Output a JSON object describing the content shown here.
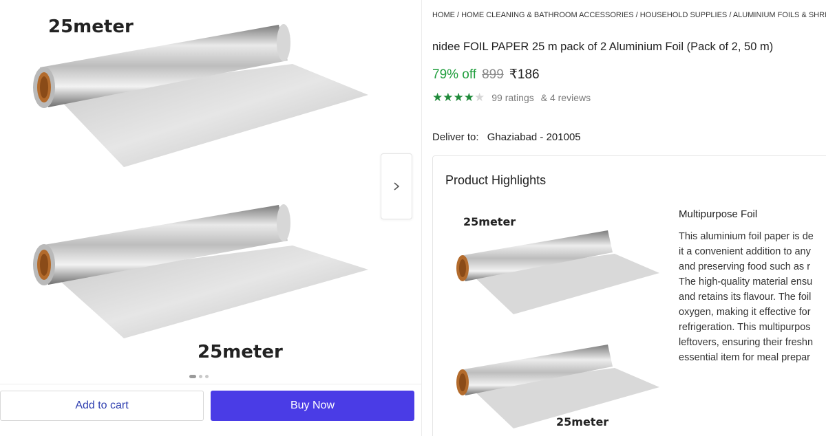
{
  "gallery": {
    "label_top": "25meter",
    "label_bottom": "25meter",
    "dots": 3,
    "active_dot": 0
  },
  "actions": {
    "add_to_cart": "Add to cart",
    "buy_now": "Buy Now"
  },
  "breadcrumb": "HOME / HOME CLEANING & BATHROOM ACCESSORIES / HOUSEHOLD SUPPLIES / ALUMINIUM FOILS & SHRINK",
  "product": {
    "title": "nidee FOIL PAPER 25 m pack of 2 Aluminium Foil (Pack of 2, 50 m)",
    "discount": "79% off",
    "mrp": "899",
    "price": "₹186",
    "rating_stars": 4,
    "ratings_text": "99 ratings",
    "reviews_text": "& 4 reviews"
  },
  "delivery": {
    "label": "Deliver to:",
    "location": "Ghaziabad - 201005"
  },
  "highlights": {
    "title": "Product Highlights",
    "image_label_top": "25meter",
    "image_label_bottom": "25meter",
    "heading": "Multipurpose Foil",
    "lines": [
      "This aluminium foil paper is de",
      "it a convenient addition to any",
      "and preserving food such as r",
      "The high-quality material ensu",
      "and retains its flavour. The foil",
      "oxygen, making it effective for",
      "refrigeration. This multipurpos",
      "leftovers, ensuring their freshn",
      "essential item for meal prepar"
    ]
  },
  "colors": {
    "discount_green": "#1f9e3c",
    "buy_button": "#4a3ce6",
    "cart_text": "#2f3fb0",
    "star_green": "#1f8a3a"
  }
}
